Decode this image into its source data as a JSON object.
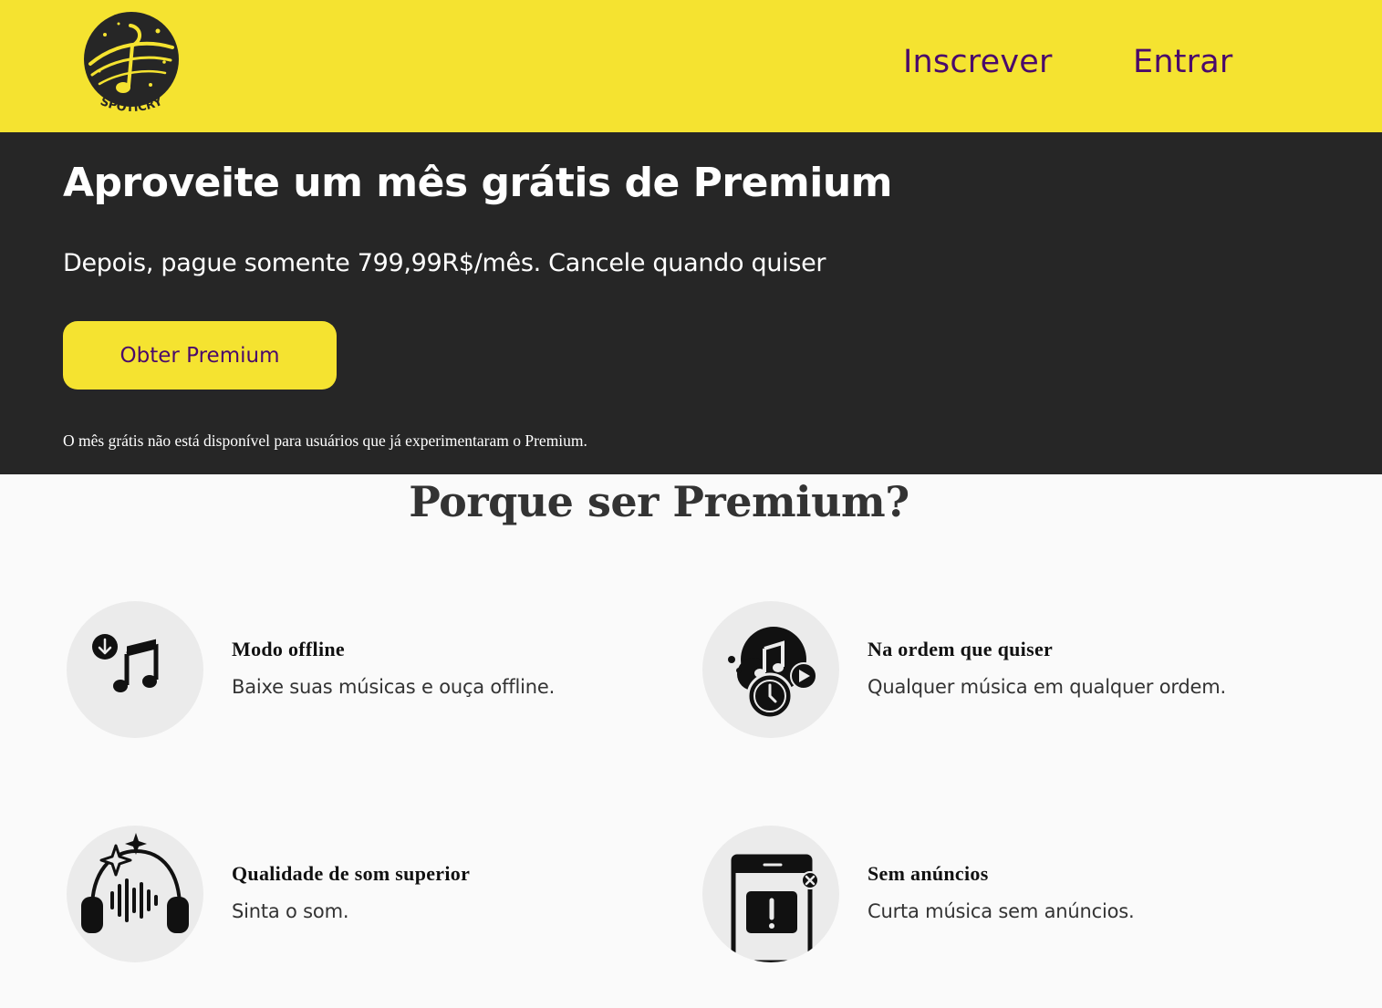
{
  "header": {
    "logo_text": "SPOTICRY",
    "nav": {
      "signup": "Inscrever",
      "login": "Entrar"
    }
  },
  "hero": {
    "title": "Aproveite um mês grátis de Premium",
    "subtitle": "Depois, pague somente 799,99R$/mês. Cancele quando quiser",
    "cta_label": "Obter Premium",
    "note": "O mês grátis não está disponível para usuários que já experimentaram o Premium."
  },
  "features": {
    "heading": "Porque ser Premium?",
    "items": [
      {
        "title": "Modo offline",
        "desc": "Baixe suas músicas e ouça offline.",
        "icon": "download-music-icon"
      },
      {
        "title": "Na ordem que quiser",
        "desc": "Qualquer música em qualquer ordem.",
        "icon": "play-order-icon"
      },
      {
        "title": "Qualidade de som superior",
        "desc": "Sinta o som.",
        "icon": "headphones-icon"
      },
      {
        "title": "Sem anúncios",
        "desc": "Curta música sem anúncios.",
        "icon": "no-ads-icon"
      }
    ]
  },
  "colors": {
    "brand_yellow": "#f5e330",
    "brand_purple": "#4a0a6b",
    "hero_bg": "#262626",
    "page_bg": "#fafafa"
  }
}
